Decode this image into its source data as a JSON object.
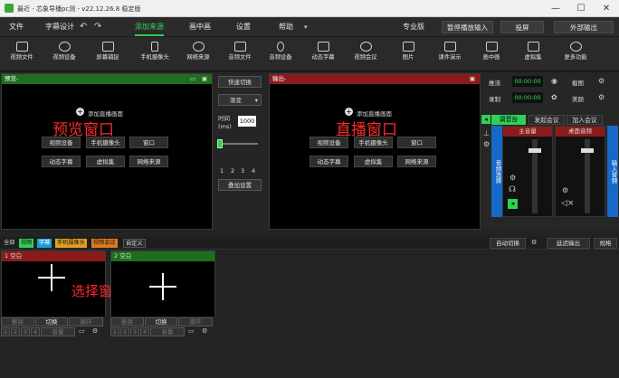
{
  "titlebar": {
    "title": "最近 - 芯象导播pc测 - v22.12.26.8 稳定版",
    "minimize": "—",
    "maximize": "☐",
    "close": "✕"
  },
  "menubar": {
    "file": "文件",
    "subtitle": "字幕设计",
    "add_source": "添加来源",
    "pip": "画中画",
    "settings": "设置",
    "help": "帮助",
    "edition": "专业版",
    "pause_input": "暂停播放输入",
    "projection": "投屏",
    "external_output": "外部输出"
  },
  "toolbar": {
    "items": [
      "视频文件",
      "视频设备",
      "屏幕捕捉",
      "手机摄像头",
      "网络来源",
      "音频文件",
      "音频设备",
      "动态字幕",
      "视频会议",
      "图片",
      "课件演示",
      "画中画",
      "虚拟集",
      "更多功能"
    ]
  },
  "preview": {
    "header": "预览-",
    "add_scene": "添加直播画面",
    "overlay_label": "预览窗口",
    "buttons": [
      "视频设备",
      "手机摄像头",
      "窗口",
      "动态字幕",
      "虚拟集",
      "网络来源"
    ]
  },
  "middle": {
    "quick_switch": "快速切换",
    "transition": "渐变",
    "time_label": "时间\n(ms)",
    "time_value": "1000",
    "pages": [
      "1",
      "2",
      "3",
      "4"
    ],
    "overlay_settings": "叠加设置"
  },
  "live": {
    "header": "输出-",
    "add_scene": "添加直播画面",
    "overlay_label": "直播窗口",
    "buttons": [
      "视频设备",
      "手机摄像头",
      "窗口",
      "动态字幕",
      "虚拟集",
      "网络来源"
    ]
  },
  "right": {
    "push_stream": "推流",
    "record": "录制",
    "push_time": "00:00:00",
    "record_time": "00:00:00",
    "screenshot": "截图",
    "beauty": "美颜",
    "tabs": [
      "调音台",
      "发起会议",
      "加入会议"
    ],
    "audio_left_tab": "音频选择",
    "audio_right_tab": "输入音频",
    "main_volume": "主音量",
    "desktop_audio": "桌面音频"
  },
  "source_tabs": {
    "all": "全部",
    "video": "视频",
    "subtitle": "字幕",
    "phone": "手机摄像头",
    "meeting": "视频会议",
    "custom": "自定义",
    "auto_switch": "自动切换",
    "delay_output": "延迟输出",
    "spec": "规格"
  },
  "scenes": [
    {
      "title": "1 空白",
      "overlay_label": "选择窗口",
      "actions": [
        "删除",
        "切换",
        "循环"
      ],
      "nums": [
        "1",
        "2",
        "3",
        "4"
      ],
      "volume": "音量"
    },
    {
      "title": "2 空白",
      "overlay_label": "",
      "actions": [
        "删除",
        "切换",
        "循环"
      ],
      "nums": [
        "1",
        "2",
        "3",
        "4"
      ],
      "volume": "音量"
    }
  ],
  "colors": {
    "accent_green": "#2fd157",
    "preview_header": "#1f6e1f",
    "live_header": "#8b1b1b",
    "overlay_red": "#ff2a2a",
    "timer_green": "#29e35a",
    "audio_blue": "#1769c7"
  }
}
